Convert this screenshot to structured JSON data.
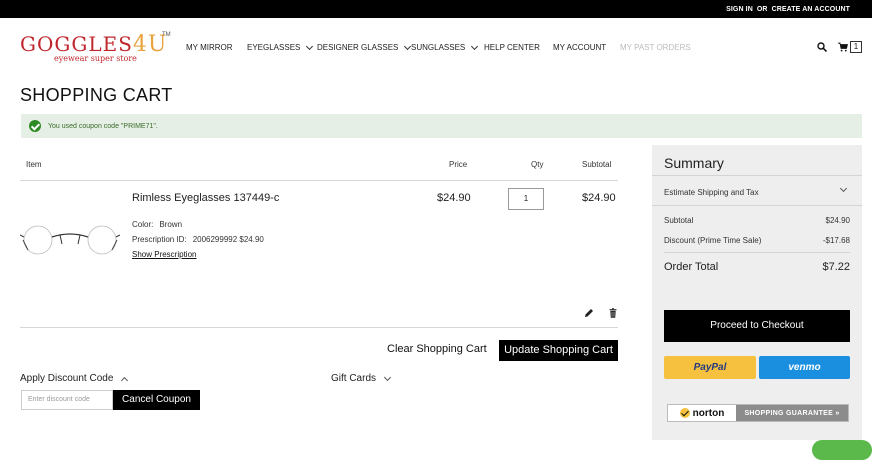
{
  "topbar": {
    "sign_in": "SIGN IN",
    "or": "OR",
    "create_account": "CREATE AN ACCOUNT"
  },
  "logo": {
    "brand": "GOGGLES",
    "brand_suffix": "4U",
    "tm": "TM",
    "tagline": "eyewear super store"
  },
  "nav": {
    "my_mirror": "MY MIRROR",
    "eyeglasses": "EYEGLASSES",
    "designer_glasses": "DESIGNER GLASSES",
    "sunglasses": "SUNGLASSES",
    "help_center": "HELP CENTER",
    "my_account": "MY ACCOUNT",
    "my_past_orders": "MY PAST ORDERS"
  },
  "cart_count": "1",
  "page_title": "SHOPPING CART",
  "notice": "You used coupon code \"PRIME71\".",
  "table": {
    "item": "Item",
    "price": "Price",
    "qty": "Qty",
    "subtotal": "Subtotal"
  },
  "product": {
    "name": "Rimless Eyeglasses 137449-c",
    "color_label": "Color:",
    "color_value": "Brown",
    "rx_label": "Prescription ID:",
    "rx_value": "2006299992 $24.90",
    "show_rx": "Show Prescription",
    "price": "$24.90",
    "qty": "1",
    "subtotal": "$24.90"
  },
  "actions": {
    "clear": "Clear Shopping Cart",
    "update": "Update Shopping Cart"
  },
  "discount": {
    "label": "Apply Discount Code",
    "placeholder": "Enter discount code",
    "cancel": "Cancel Coupon"
  },
  "gift_cards": "Gift Cards",
  "summary": {
    "title": "Summary",
    "estimate": "Estimate Shipping and Tax",
    "subtotal_label": "Subtotal",
    "subtotal_value": "$24.90",
    "discount_label": "Discount (Prime Time Sale)",
    "discount_value": "-$17.68",
    "total_label": "Order Total",
    "total_value": "$7.22",
    "checkout": "Proceed to Checkout",
    "paypal": "PayPal",
    "venmo": "venmo",
    "norton": "norton",
    "guarantee": "SHOPPING GUARANTEE »"
  },
  "colors": {
    "brand_red": "#c0272d",
    "notice_bg": "#e5efe5",
    "success_green": "#2e8b23"
  }
}
